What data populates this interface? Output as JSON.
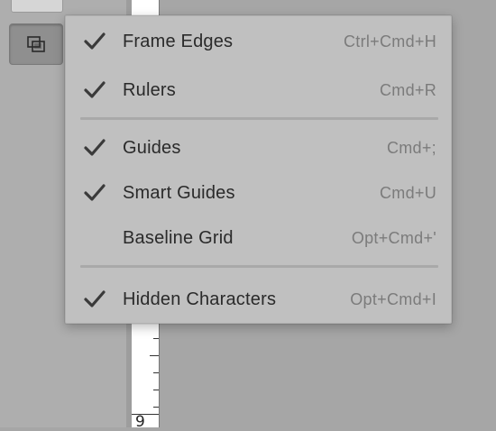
{
  "toolbar": {
    "view_options_button": "view-options",
    "icon": "frame-edges-icon"
  },
  "ruler": {
    "visible_number": "9"
  },
  "menu": {
    "items": [
      {
        "label": "Frame Edges",
        "shortcut": "Ctrl+Cmd+H",
        "checked": true
      },
      {
        "label": "Rulers",
        "shortcut": "Cmd+R",
        "checked": true
      },
      {
        "label": "Guides",
        "shortcut": "Cmd+;",
        "checked": true
      },
      {
        "label": "Smart Guides",
        "shortcut": "Cmd+U",
        "checked": true
      },
      {
        "label": "Baseline Grid",
        "shortcut": "Opt+Cmd+'",
        "checked": false
      },
      {
        "label": "Hidden Characters",
        "shortcut": "Opt+Cmd+I",
        "checked": true
      }
    ]
  },
  "colors": {
    "menu_background": "#c0c0c0",
    "label_text": "#2a2a2a",
    "shortcut_text": "#7b7b7b",
    "check_mark": "#3a3a3a"
  }
}
